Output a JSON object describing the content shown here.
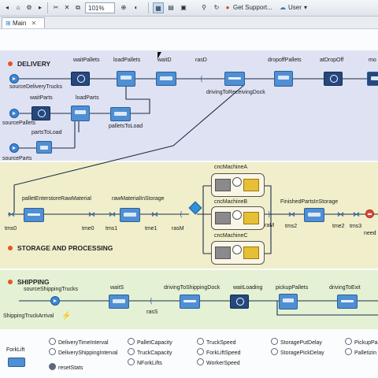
{
  "toolbar": {
    "zoom": "101%",
    "get_support": "Get Support...",
    "user": "User",
    "icons": [
      "back-icon",
      "home-icon",
      "settings-icon",
      "run-icon",
      "stop-icon",
      "delete-icon",
      "cut-icon",
      "copy-icon",
      "paste-icon",
      "zoom-icon",
      "palette-icon",
      "grid-icon",
      "layout-icon",
      "link-icon",
      "refresh-icon",
      "support-icon",
      "cloud-icon"
    ]
  },
  "tab": {
    "label": "Main"
  },
  "sections": {
    "delivery": "DELIVERY",
    "storage": "STORAGE AND PROCESSING",
    "shipping": "SHIPPING"
  },
  "delivery": {
    "source_trucks": "sourceDeliveryTrucks",
    "wait_pallets": "waitPallets",
    "load_pallets": "loadPallets",
    "wait_d": "waitD",
    "ras_d": "rasD",
    "dropoff_pallets": "dropoffPallets",
    "at_dropoff": "atDropOff",
    "mo": "mo",
    "driving_to_receiving": "drivingToReceivingDock",
    "wait_parts": "waitParts",
    "load_parts": "loadParts",
    "source_pallets": "sourcePallets",
    "parts_to_load": "partsToLoad",
    "pallets_to_load": "palletsToLoad",
    "source_parts": "sourceParts"
  },
  "storage": {
    "tms0": "tms0",
    "pallet_enter": "palletEnterstoreRawMaterial",
    "tme0": "tme0",
    "tms1": "tms1",
    "raw_material": "rawMaterialInStorage",
    "tme1": "tme1",
    "ras_m": "rasM",
    "cnc_a": "cncMachineA",
    "cnc_b": "cncMachineB",
    "cnc_c": "cncMachineC",
    "ra_m": "raM",
    "tms2": "tms2",
    "finished_parts": "FinishedPartsInStorage",
    "tme2": "tme2",
    "tms3": "tms3",
    "need": "need"
  },
  "shipping": {
    "source_trucks": "sourceShippingTrucks",
    "wait_s": "waitS",
    "driving_to_dock": "drivingToShippingDock",
    "wait_loading": "waitLoading",
    "pickup_pallets": "pickupPallets",
    "driving_to_exit": "drivingToExit",
    "ras_s": "rasS",
    "arrival": "ShippingTruckArrival"
  },
  "params": {
    "forklift": "ForkLift",
    "col1": [
      "DeliveryTimeInterval",
      "DeliveryShippingInterval"
    ],
    "reset": "resetStats",
    "col2": [
      "PalletCapacity",
      "TruckCapacity",
      "NForkLifts"
    ],
    "col3": [
      "TruckSpeed",
      "ForkLiftSpeed",
      "WorkerSpeed"
    ],
    "col4": [
      "StoragePutDelay",
      "StoragePickDelay"
    ],
    "col5": [
      "PickupPa",
      "Palletizin"
    ]
  },
  "colors": {
    "delivery_bg": "#dfe2f3",
    "storage_bg": "#f1eecb",
    "shipping_bg": "#e4f1d4",
    "block_blue": "#4f8fd3",
    "block_dark": "#25487e",
    "section_dot": "#e2571e"
  }
}
